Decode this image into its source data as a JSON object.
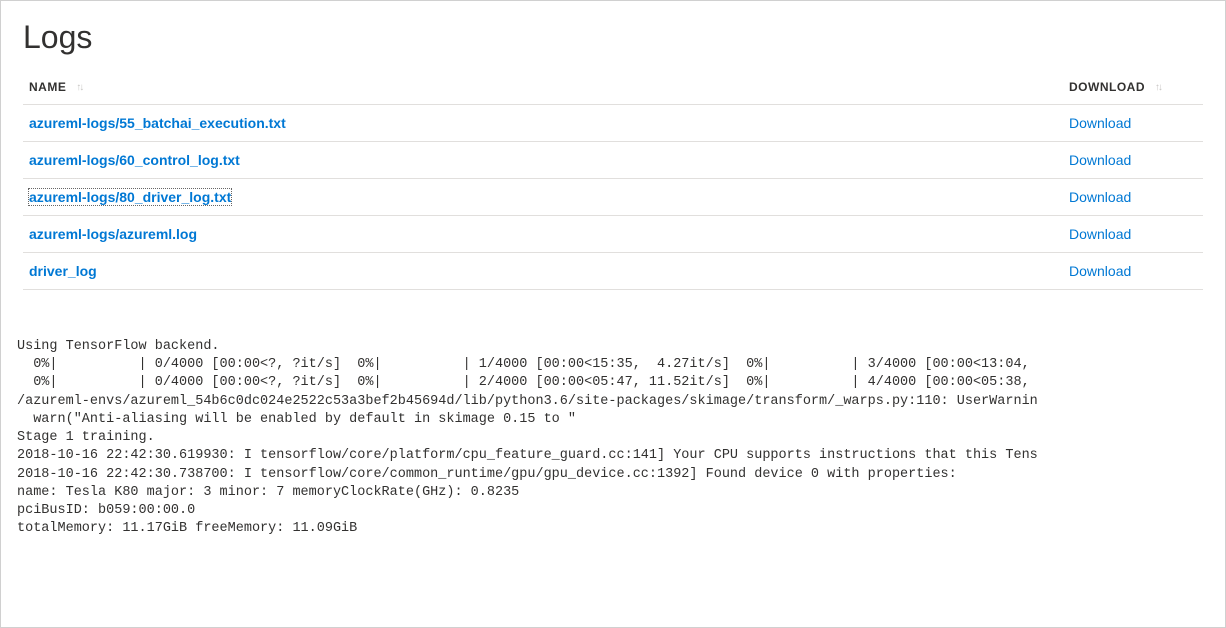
{
  "title": "Logs",
  "columns": {
    "name": "NAME",
    "download": "DOWNLOAD"
  },
  "rows": [
    {
      "name": "azureml-logs/55_batchai_execution.txt",
      "download": "Download",
      "selected": false
    },
    {
      "name": "azureml-logs/60_control_log.txt",
      "download": "Download",
      "selected": false
    },
    {
      "name": "azureml-logs/80_driver_log.txt",
      "download": "Download",
      "selected": true
    },
    {
      "name": "azureml-logs/azureml.log",
      "download": "Download",
      "selected": false
    },
    {
      "name": "driver_log",
      "download": "Download",
      "selected": false
    }
  ],
  "logText": "Using TensorFlow backend.\n  0%|          | 0/4000 [00:00<?, ?it/s]  0%|          | 1/4000 [00:00<15:35,  4.27it/s]  0%|          | 3/4000 [00:00<13:04,\n  0%|          | 0/4000 [00:00<?, ?it/s]  0%|          | 2/4000 [00:00<05:47, 11.52it/s]  0%|          | 4/4000 [00:00<05:38,\n/azureml-envs/azureml_54b6c0dc024e2522c53a3bef2b45694d/lib/python3.6/site-packages/skimage/transform/_warps.py:110: UserWarnin\n  warn(\"Anti-aliasing will be enabled by default in skimage 0.15 to \"\nStage 1 training.\n2018-10-16 22:42:30.619930: I tensorflow/core/platform/cpu_feature_guard.cc:141] Your CPU supports instructions that this Tens\n2018-10-16 22:42:30.738700: I tensorflow/core/common_runtime/gpu/gpu_device.cc:1392] Found device 0 with properties:\nname: Tesla K80 major: 3 minor: 7 memoryClockRate(GHz): 0.8235\npciBusID: b059:00:00.0\ntotalMemory: 11.17GiB freeMemory: 11.09GiB"
}
